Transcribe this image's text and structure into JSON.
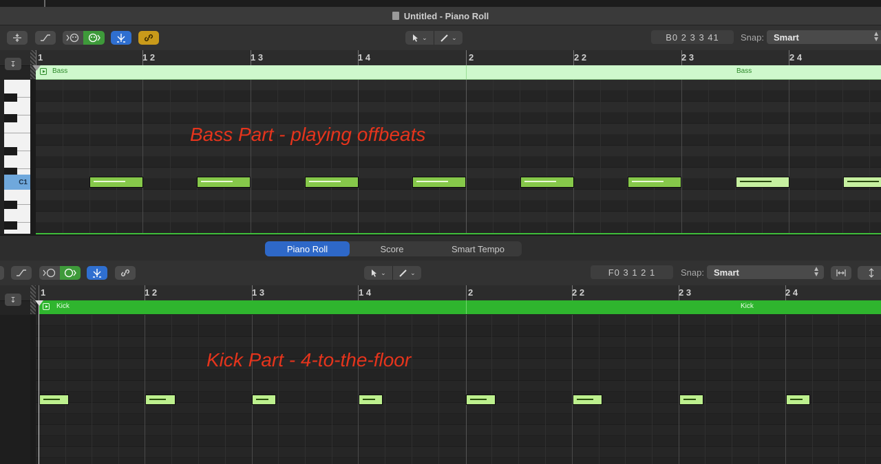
{
  "window": {
    "title": "Untitled - Piano Roll"
  },
  "top_editor": {
    "position_display": "B0   2 3 3 41",
    "snap_label": "Snap:",
    "snap_value": "Smart",
    "ruler_labels": [
      "1",
      "1 2",
      "1 3",
      "1 4",
      "2",
      "2 2",
      "2 3",
      "2 4"
    ],
    "region_name": "Bass",
    "region_name_repeat": "Bass",
    "key_label": "C1",
    "annotation": "Bass Part - playing offbeats",
    "notes_count_visible": 8
  },
  "tabs": [
    {
      "label": "Piano Roll",
      "active": true
    },
    {
      "label": "Score",
      "active": false
    },
    {
      "label": "Smart Tempo",
      "active": false
    }
  ],
  "bottom_editor": {
    "position_display": "F0   3 1 2 1",
    "snap_label": "Snap:",
    "snap_value": "Smart",
    "ruler_labels": [
      "1",
      "1 2",
      "1 3",
      "1 4",
      "2",
      "2 2",
      "2 3",
      "2 4"
    ],
    "region_name": "Kick",
    "region_name_repeat": "Kick",
    "annotation": "Kick Part - 4-to-the-floor",
    "notes_count_visible": 8
  },
  "icons": {
    "toolbar": [
      "collapse-icon",
      "automation-curve-icon",
      "midi-in-icon",
      "midi-out-icon",
      "catch-icon",
      "link-icon",
      "pointer-tool-icon",
      "pencil-tool-icon"
    ],
    "colors": {
      "bass_region": "#cef8cc",
      "kick_region": "#2fb52e",
      "note": "#86c84a",
      "annotation": "#e5341c",
      "accent_blue": "#2e68c8"
    }
  }
}
